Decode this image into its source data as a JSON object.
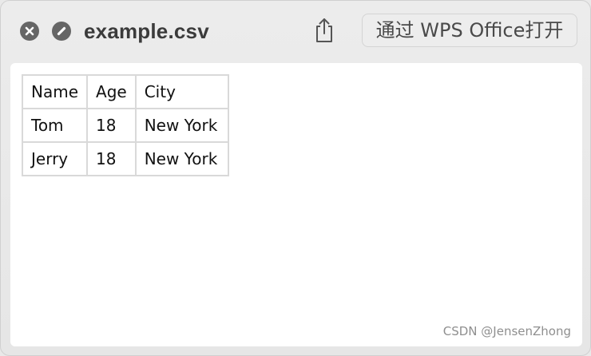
{
  "window": {
    "title": "example.csv",
    "open_with_label": "通过 WPS Office打开"
  },
  "icons": {
    "close": "close-circle-icon",
    "minimize": "minimize-slash-icon",
    "share": "share-icon"
  },
  "table": {
    "rows": [
      [
        "Name",
        "Age",
        "City"
      ],
      [
        "Tom",
        "18",
        "New York"
      ],
      [
        "Jerry",
        "18",
        "New York"
      ]
    ]
  },
  "watermark": "CSDN @JensenZhong"
}
